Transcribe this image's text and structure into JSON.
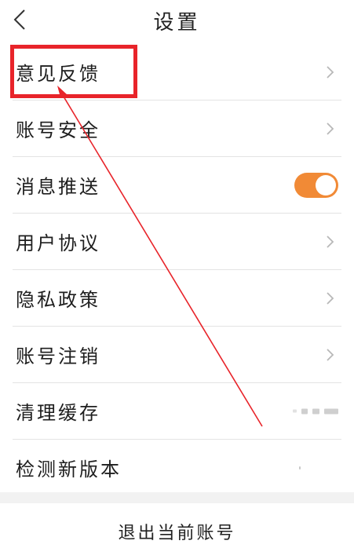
{
  "header": {
    "title": "设置"
  },
  "settings": {
    "items": [
      {
        "label": "意见反馈",
        "control": "chevron"
      },
      {
        "label": "账号安全",
        "control": "chevron"
      },
      {
        "label": "消息推送",
        "control": "toggle",
        "toggle_on": true
      },
      {
        "label": "用户协议",
        "control": "chevron"
      },
      {
        "label": "隐私政策",
        "control": "chevron"
      },
      {
        "label": "账号注销",
        "control": "chevron"
      },
      {
        "label": "清理缓存",
        "control": "value"
      },
      {
        "label": "检测新版本",
        "control": "value"
      }
    ]
  },
  "footer": {
    "logout_label": "退出当前账号"
  },
  "colors": {
    "accent": "#f18a36",
    "annotation": "#e8242a"
  },
  "icons": {
    "back": "back-chevron-icon",
    "row_arrow": "chevron-right-icon"
  }
}
